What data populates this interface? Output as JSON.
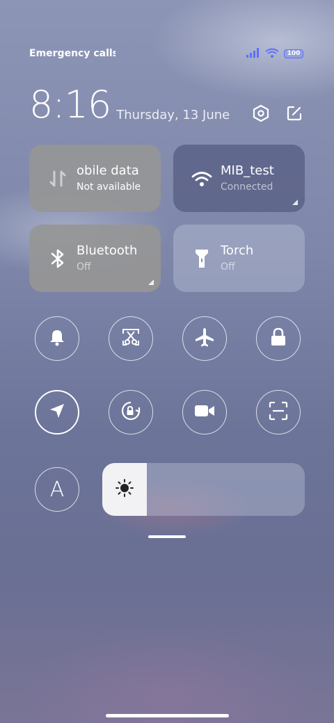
{
  "status_bar": {
    "carrier_text": "Emergency calls o",
    "battery": "100",
    "icons": [
      "signal-icon",
      "wifi-icon",
      "battery-icon"
    ]
  },
  "header": {
    "time": "8:16",
    "date": "Thursday, 13 June",
    "actions": [
      "settings-hex-icon",
      "edit-icon"
    ]
  },
  "tiles": [
    {
      "id": "mobile-data",
      "title": "obile data",
      "subtitle": "Not available",
      "icon": "data-arrows-icon"
    },
    {
      "id": "wifi",
      "title": "MIB_test",
      "subtitle": "Connected",
      "icon": "wifi-icon"
    },
    {
      "id": "bluetooth",
      "title": "Bluetooth",
      "subtitle": "Off",
      "icon": "bluetooth-icon"
    },
    {
      "id": "torch",
      "title": "Torch",
      "subtitle": "Off",
      "icon": "flashlight-icon"
    }
  ],
  "toggles_row1": [
    "bell-icon",
    "screenshot-scissors-icon",
    "airplane-icon",
    "lock-icon"
  ],
  "toggles_row2": [
    "location-arrow-icon",
    "rotation-lock-icon",
    "video-camera-icon",
    "scan-icon"
  ],
  "auto_brightness_label": "A",
  "brightness": {
    "level": 0.22,
    "icon": "sun-icon"
  },
  "colors": {
    "tile_grey": "#969696",
    "tile_dark": "#555c82",
    "accent_battery": "#5b6fff"
  }
}
